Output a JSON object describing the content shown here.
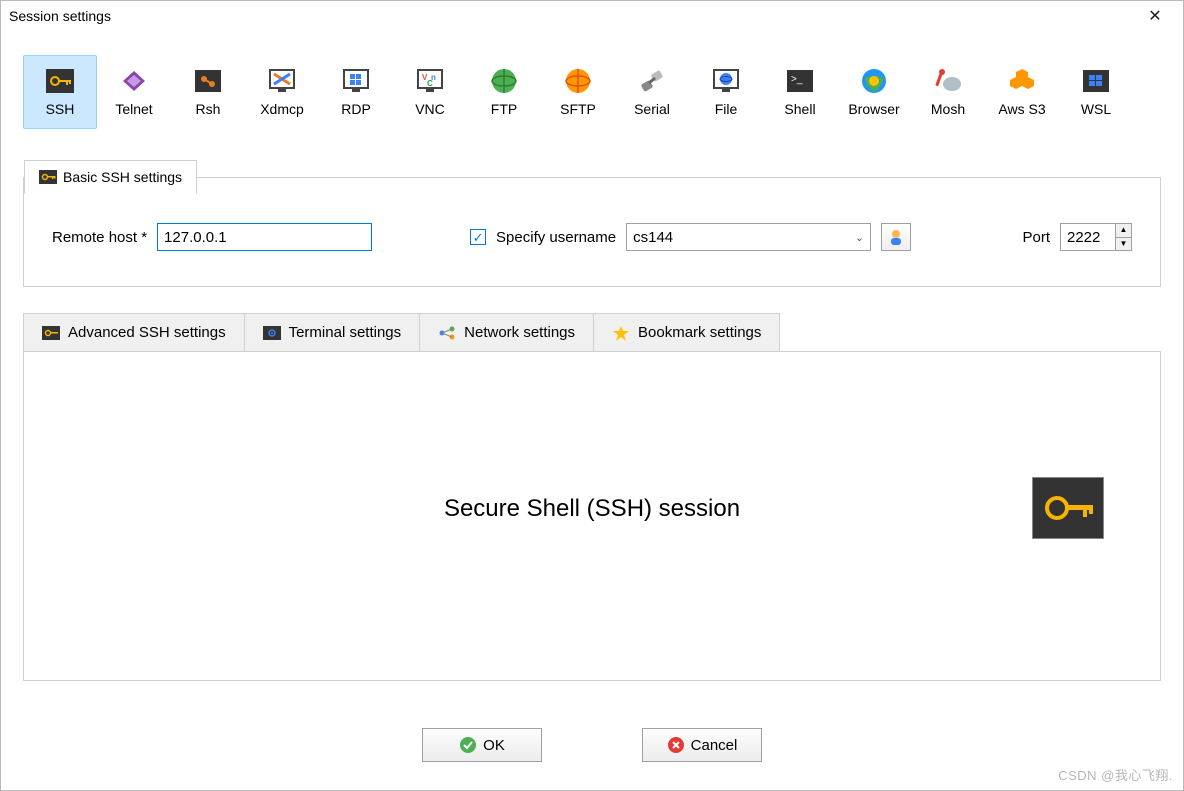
{
  "title": "Session settings",
  "types": [
    {
      "id": "ssh",
      "label": "SSH"
    },
    {
      "id": "telnet",
      "label": "Telnet"
    },
    {
      "id": "rsh",
      "label": "Rsh"
    },
    {
      "id": "xdmcp",
      "label": "Xdmcp"
    },
    {
      "id": "rdp",
      "label": "RDP"
    },
    {
      "id": "vnc",
      "label": "VNC"
    },
    {
      "id": "ftp",
      "label": "FTP"
    },
    {
      "id": "sftp",
      "label": "SFTP"
    },
    {
      "id": "serial",
      "label": "Serial"
    },
    {
      "id": "file",
      "label": "File"
    },
    {
      "id": "shell",
      "label": "Shell"
    },
    {
      "id": "browser",
      "label": "Browser"
    },
    {
      "id": "mosh",
      "label": "Mosh"
    },
    {
      "id": "awss3",
      "label": "Aws S3"
    },
    {
      "id": "wsl",
      "label": "WSL"
    }
  ],
  "basic": {
    "tab_label": "Basic SSH settings",
    "remote_host_label": "Remote host *",
    "remote_host_value": "127.0.0.1",
    "specify_username_label": "Specify username",
    "specify_username_checked": true,
    "username_value": "cs144",
    "port_label": "Port",
    "port_value": "2222"
  },
  "sub_tabs": {
    "advanced": "Advanced SSH settings",
    "terminal": "Terminal settings",
    "network": "Network settings",
    "bookmark": "Bookmark settings"
  },
  "session_title": "Secure Shell (SSH) session",
  "buttons": {
    "ok": "OK",
    "cancel": "Cancel"
  },
  "watermark": "CSDN @我心飞翔."
}
